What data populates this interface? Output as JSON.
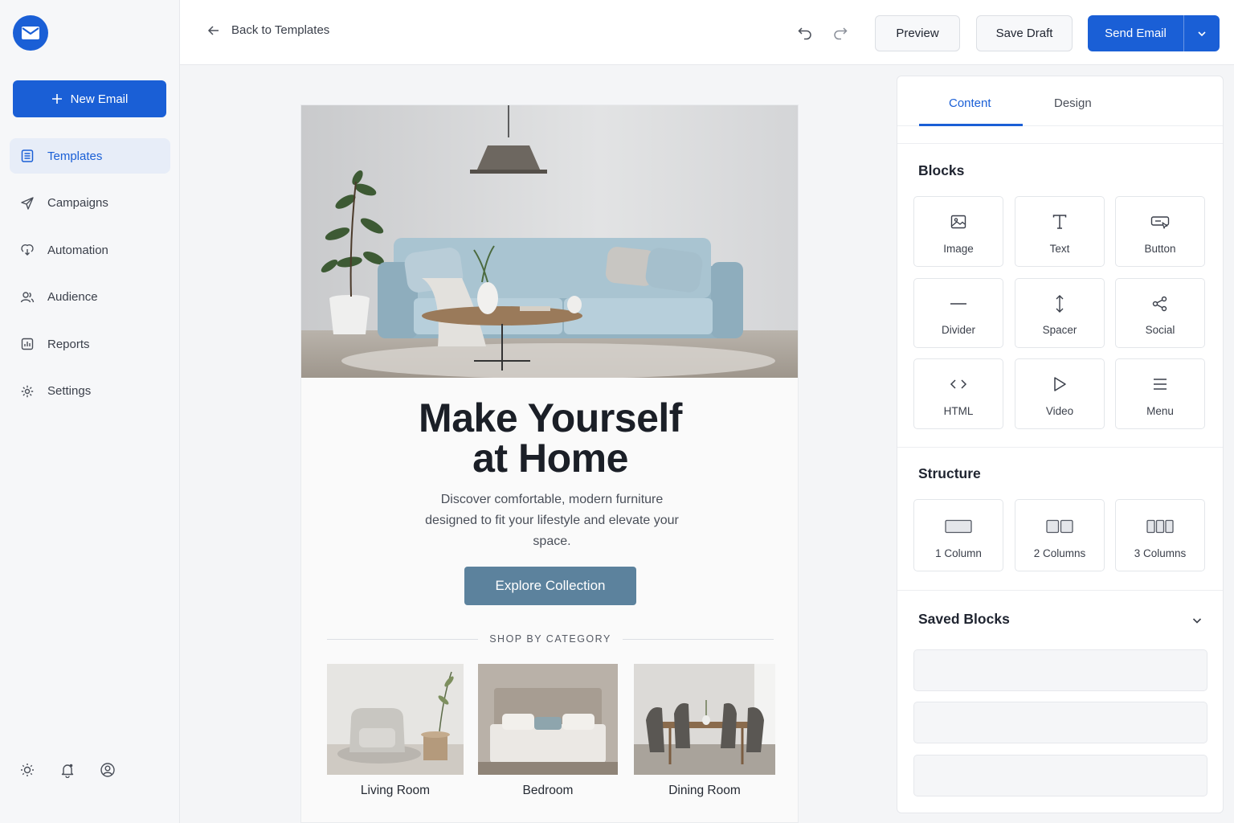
{
  "sidebar": {
    "new_email_label": "New Email",
    "items": [
      {
        "label": "Templates",
        "icon": "template-icon",
        "active": true
      },
      {
        "label": "Campaigns",
        "icon": "paper-plane-icon"
      },
      {
        "label": "Automation",
        "icon": "automation-icon"
      },
      {
        "label": "Audience",
        "icon": "users-icon"
      },
      {
        "label": "Reports",
        "icon": "report-icon"
      },
      {
        "label": "Settings",
        "icon": "gear-icon"
      }
    ]
  },
  "topbar": {
    "back_label": "Back to Templates",
    "preview_label": "Preview",
    "save_draft_label": "Save Draft",
    "send_label": "Send Email"
  },
  "email": {
    "headline_line1": "Make Yourself",
    "headline_line2": "at Home",
    "subtext": "Discover comfortable, modern furniture designed to fit your lifestyle and elevate your space.",
    "cta_label": "Explore Collection",
    "category_heading": "SHOP BY CATEGORY",
    "categories": [
      {
        "label": "Living Room"
      },
      {
        "label": "Bedroom"
      },
      {
        "label": "Dining Room"
      }
    ]
  },
  "panel": {
    "tabs": [
      "Content",
      "Design"
    ],
    "blocks_title": "Blocks",
    "blocks": [
      "Image",
      "Text",
      "Button",
      "Divider",
      "Spacer",
      "Social",
      "HTML",
      "Video",
      "Menu"
    ],
    "structure_title": "Structure",
    "structures": [
      "1 Column",
      "2 Columns",
      "3 Columns"
    ],
    "saved_title": "Saved Blocks"
  },
  "colors": {
    "primary": "#1a5fd6",
    "cta": "#5c829d"
  }
}
